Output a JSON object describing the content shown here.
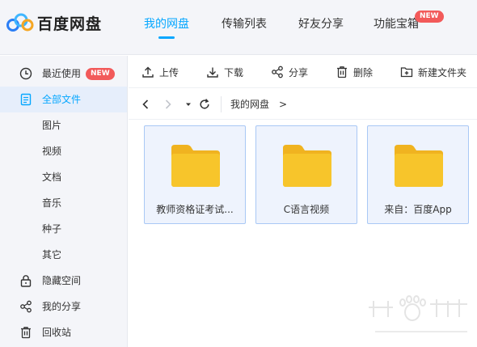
{
  "header": {
    "logo_text": "百度网盘",
    "tabs": [
      {
        "label": "我的网盘",
        "active": true
      },
      {
        "label": "传输列表",
        "active": false
      },
      {
        "label": "好友分享",
        "active": false
      },
      {
        "label": "功能宝箱",
        "active": false,
        "badge": "NEW"
      }
    ]
  },
  "sidebar": {
    "items": [
      {
        "label": "最近使用",
        "icon": "clock-icon",
        "badge": "NEW",
        "active": false
      },
      {
        "label": "全部文件",
        "icon": "document-icon",
        "active": true
      },
      {
        "label": "图片",
        "active": false
      },
      {
        "label": "视频",
        "active": false
      },
      {
        "label": "文档",
        "active": false
      },
      {
        "label": "音乐",
        "active": false
      },
      {
        "label": "种子",
        "active": false
      },
      {
        "label": "其它",
        "active": false
      },
      {
        "label": "隐藏空间",
        "icon": "lock-icon",
        "active": false
      },
      {
        "label": "我的分享",
        "icon": "share-icon",
        "active": false
      },
      {
        "label": "回收站",
        "icon": "trash-icon",
        "active": false
      }
    ]
  },
  "toolbar": {
    "upload": "上传",
    "download": "下载",
    "share": "分享",
    "delete": "删除",
    "new_folder": "新建文件夹"
  },
  "addressbar": {
    "crumb": "我的网盘",
    "separator": ">"
  },
  "files": [
    {
      "name": "教师资格证考试...",
      "type": "folder"
    },
    {
      "name": "C语言视频",
      "type": "folder"
    },
    {
      "name": "来自：百度App",
      "type": "folder"
    }
  ],
  "colors": {
    "accent": "#06a7ff",
    "badge": "#f25a5a",
    "folder": "#f7c52b"
  }
}
